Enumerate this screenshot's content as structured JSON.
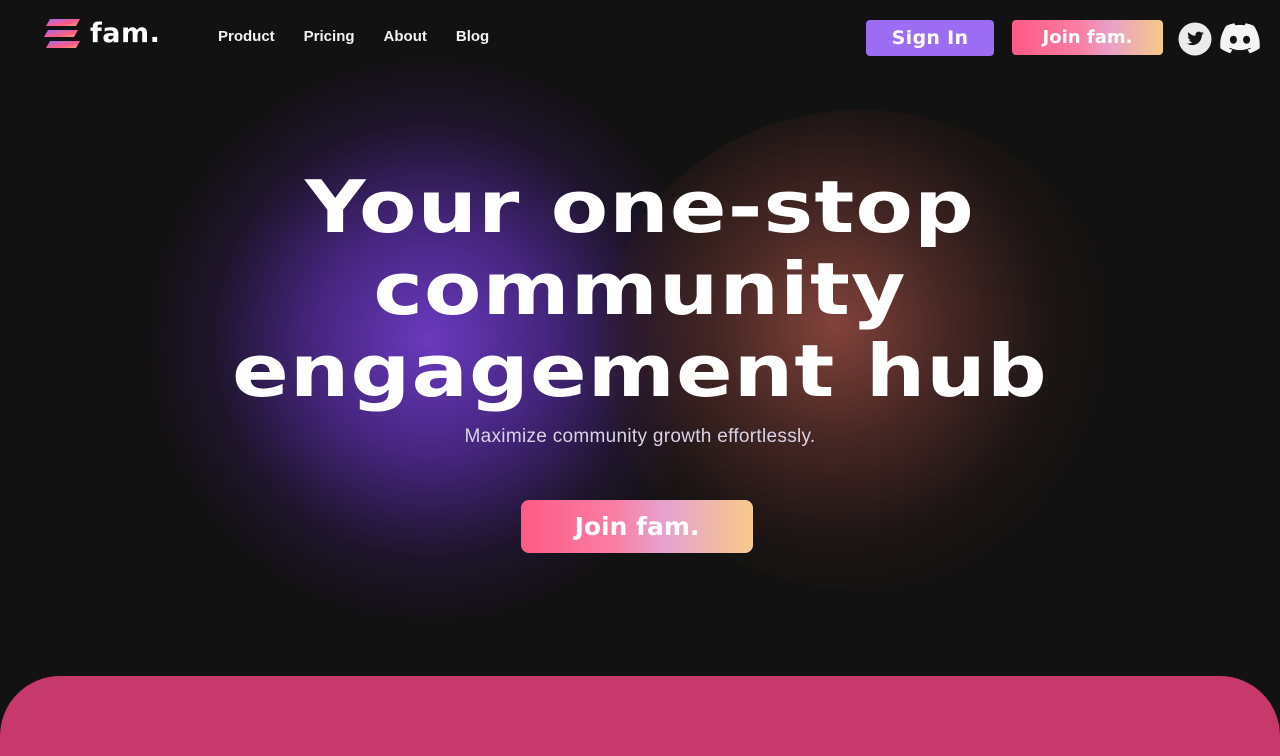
{
  "brand": {
    "name": "fam."
  },
  "nav": {
    "links": [
      "Product",
      "Pricing",
      "About",
      "Blog"
    ],
    "sign_in": "Sign In",
    "join": "Join fam.",
    "social": [
      "twitter-icon",
      "discord-icon"
    ]
  },
  "hero": {
    "title_lines": [
      "Your one-stop",
      "community",
      "engagement hub"
    ],
    "subtitle": "Maximize community growth effortlessly.",
    "cta": "Join fam."
  },
  "colors": {
    "background": "#121212",
    "sign_in": "#9c6cf2",
    "join_gradient": [
      "#ff5a86",
      "#f97ea4",
      "#e9a0c8",
      "#f6c987"
    ],
    "band": "#c7386b",
    "glow_purple": "#6e3cc8",
    "glow_salmon": "#964b41"
  }
}
